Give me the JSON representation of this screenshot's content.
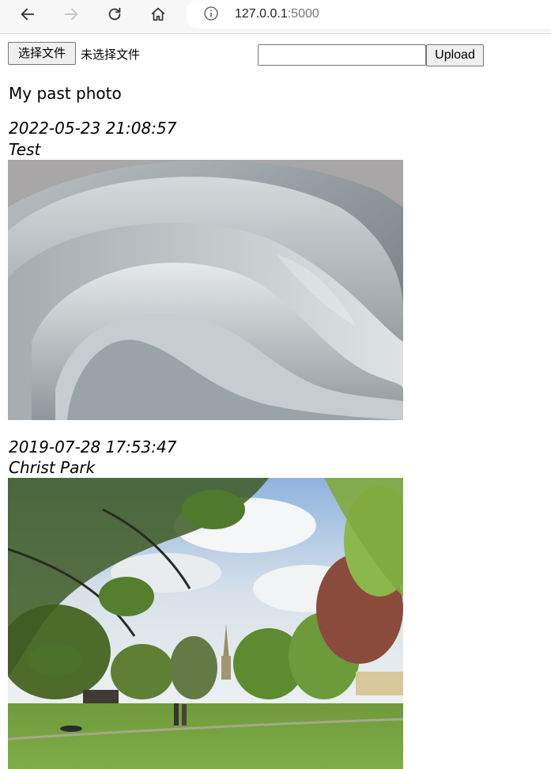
{
  "browser": {
    "url_host": "127.0.0.1",
    "url_port": ":5000",
    "back_icon": "arrow-left-icon",
    "forward_icon": "arrow-right-icon",
    "reload_icon": "reload-icon",
    "home_icon": "home-icon",
    "site_info_icon": "info-icon"
  },
  "upload": {
    "choose_file_label": "选择文件",
    "no_file_text": "未选择文件",
    "caption_value": "",
    "upload_label": "Upload"
  },
  "page": {
    "heading": "My past photo"
  },
  "photos": [
    {
      "date": "2022-05-23 21:08:57",
      "caption": "Test",
      "image": "abstract-grey-wave-image"
    },
    {
      "date": "2019-07-28 17:53:47",
      "caption": "Christ Park",
      "image": "park-landscape-image"
    }
  ]
}
